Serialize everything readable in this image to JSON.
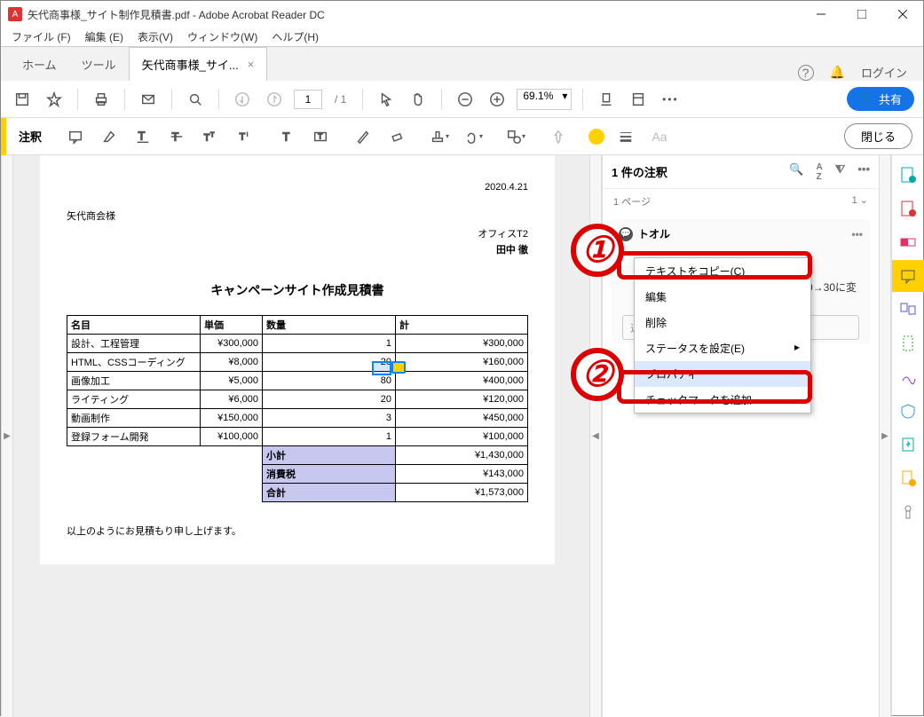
{
  "window": {
    "title": "矢代商事様_サイト制作見積書.pdf - Adobe Acrobat Reader DC"
  },
  "menus": [
    "ファイル (F)",
    "編集 (E)",
    "表示(V)",
    "ウィンドウ(W)",
    "ヘルプ(H)"
  ],
  "tabs": {
    "home": "ホーム",
    "tools": "ツール",
    "doc": "矢代商事様_サイ...",
    "login": "ログイン"
  },
  "toolbar": {
    "page_current": "1",
    "page_total": "/ 1",
    "zoom": "69.1%",
    "share": "共有"
  },
  "annobar": {
    "label": "注釈",
    "close": "閉じる"
  },
  "doc": {
    "date": "2020.4.21",
    "addressee": "矢代商会様",
    "from_company": "オフィスT2",
    "from_person": "田中 徹",
    "title": "キャンペーンサイト作成見積書",
    "headers": {
      "name": "名目",
      "unit": "単価",
      "qty": "数量",
      "total": "計"
    },
    "rows": [
      {
        "name": "設計、工程管理",
        "unit": "¥300,000",
        "qty": "1",
        "total": "¥300,000"
      },
      {
        "name": "HTML、CSSコーディング",
        "unit": "¥8,000",
        "qty": "20",
        "total": "¥160,000"
      },
      {
        "name": "画像加工",
        "unit": "¥5,000",
        "qty": "80",
        "total": "¥400,000"
      },
      {
        "name": "ライティング",
        "unit": "¥6,000",
        "qty": "20",
        "total": "¥120,000"
      },
      {
        "name": "動画制作",
        "unit": "¥150,000",
        "qty": "3",
        "total": "¥450,000"
      },
      {
        "name": "登録フォーム開発",
        "unit": "¥100,000",
        "qty": "1",
        "total": "¥100,000"
      }
    ],
    "sums": {
      "subtotal_l": "小計",
      "subtotal_v": "¥1,430,000",
      "tax_l": "消費税",
      "tax_v": "¥143,000",
      "total_l": "合計",
      "total_v": "¥1,573,000"
    },
    "footer": "以上のようにお見積もり申し上げます。"
  },
  "panel": {
    "head": "1 件の注釈",
    "page_label": "1 ページ",
    "page_num": "1",
    "author": "トオル",
    "body_frag": "0→30に変",
    "reply_ph": "返信を追加..."
  },
  "ctx": {
    "copy": "テキストをコピー(C)",
    "edit": "編集",
    "delete": "削除",
    "status": "ステータスを設定(E)",
    "props": "プロパティ",
    "check": "チェックマークを追加"
  }
}
